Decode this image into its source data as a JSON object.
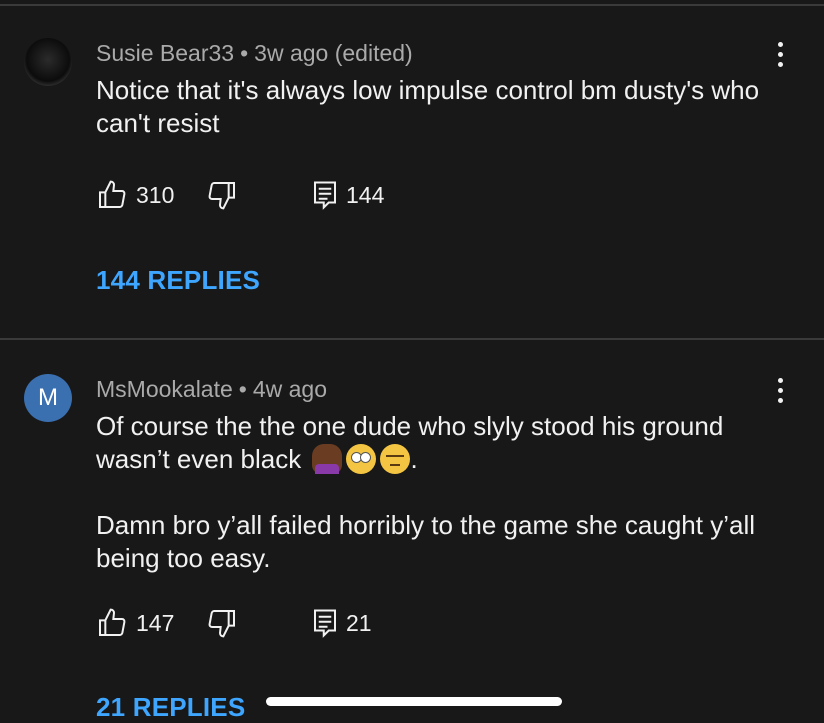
{
  "comments": [
    {
      "author": "Susie Bear33",
      "time": "3w ago (edited)",
      "text": "Notice that it's always low impulse control bm dusty's who can't resist",
      "likes": "310",
      "reply_count": "144",
      "replies_label": "144 REPLIES",
      "avatar_icon": "profile-photo-avatar"
    },
    {
      "author": "MsMookalate",
      "time": "4w ago",
      "avatar_letter": "M",
      "avatar_color": "#3a6fb0",
      "text_line1": "Of course the the one dude who slyly stood his ground wasn’t even black",
      "text_emojis": [
        "woman-facepalming-emoji",
        "face-with-rolling-eyes-emoji",
        "unamused-face-emoji"
      ],
      "text_line1_end": ".",
      "text_paragraph2": "Damn bro y’all failed horribly to the game she caught y’all being too easy.",
      "likes": "147",
      "reply_count": "21",
      "replies_label": "21 REPLIES"
    }
  ],
  "theme": {
    "background": "#181818",
    "link": "#3ea6ff",
    "meta": "#aaaaaa"
  }
}
